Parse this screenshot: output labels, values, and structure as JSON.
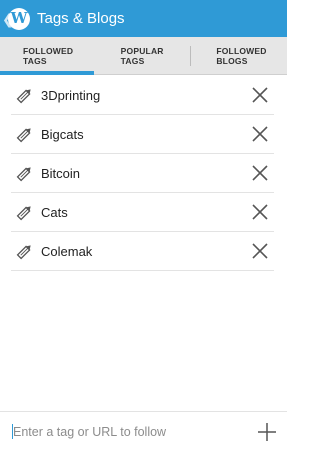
{
  "app": {
    "title": "Tags & Blogs",
    "logo_letter": "W",
    "accent_color": "#2f9ad6"
  },
  "tabs": [
    {
      "label": "FOLLOWED TAGS",
      "active": true
    },
    {
      "label": "POPULAR TAGS",
      "active": false
    },
    {
      "label": "FOLLOWED BLOGS",
      "active": false
    }
  ],
  "tags": [
    {
      "label": "3Dprinting",
      "icon": "tag-pencil-icon",
      "action_icon": "close-icon"
    },
    {
      "label": "Bigcats",
      "icon": "tag-pencil-icon",
      "action_icon": "close-icon"
    },
    {
      "label": "Bitcoin",
      "icon": "tag-pencil-icon",
      "action_icon": "close-icon"
    },
    {
      "label": "Cats",
      "icon": "tag-pencil-icon",
      "action_icon": "close-icon"
    },
    {
      "label": "Colemak",
      "icon": "tag-pencil-icon",
      "action_icon": "close-icon"
    }
  ],
  "footer": {
    "input_value": "",
    "input_placeholder": "Enter a tag or URL to follow",
    "add_icon": "plus-icon"
  }
}
